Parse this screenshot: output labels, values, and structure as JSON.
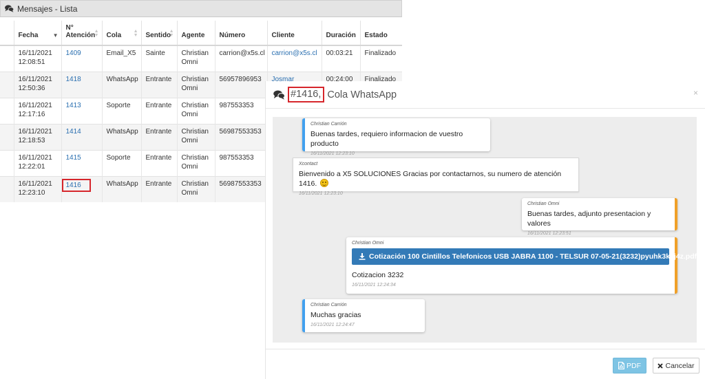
{
  "list_panel": {
    "title": "Mensajes - Lista",
    "columns": [
      "Fecha",
      "N° Atención",
      "Cola",
      "Sentido",
      "Agente",
      "Número",
      "Cliente",
      "Duración",
      "Estado"
    ],
    "rows": [
      {
        "fecha": "16/11/2021 12:08:51",
        "atencion": "1409",
        "cola": "Email_X5",
        "sentido": "Sainte",
        "agente": "Christian Omni",
        "numero": "carrion@x5s.cl",
        "cliente": "carrion@x5s.cl",
        "duracion": "00:03:21",
        "estado": "Finalizado"
      },
      {
        "fecha": "16/11/2021 12:50:36",
        "atencion": "1418",
        "cola": "WhatsApp",
        "sentido": "Entrante",
        "agente": "Christian Omni",
        "numero": "56957896953",
        "cliente": "Josmar",
        "duracion": "00:24:00",
        "estado": "Finalizado"
      },
      {
        "fecha": "16/11/2021 12:17:16",
        "atencion": "1413",
        "cola": "Soporte",
        "sentido": "Entrante",
        "agente": "Christian Omni",
        "numero": "987553353",
        "cliente": "",
        "duracion": "",
        "estado": ""
      },
      {
        "fecha": "16/11/2021 12:18:53",
        "atencion": "1414",
        "cola": "WhatsApp",
        "sentido": "Entrante",
        "agente": "Christian Omni",
        "numero": "56987553353",
        "cliente": "",
        "duracion": "",
        "estado": ""
      },
      {
        "fecha": "16/11/2021 12:22:01",
        "atencion": "1415",
        "cola": "Soporte",
        "sentido": "Entrante",
        "agente": "Christian Omni",
        "numero": "987553353",
        "cliente": "",
        "duracion": "",
        "estado": ""
      },
      {
        "fecha": "16/11/2021 12:23:10",
        "atencion": "1416",
        "cola": "WhatsApp",
        "sentido": "Entrante",
        "agente": "Christian Omni",
        "numero": "56987553353",
        "cliente": "",
        "duracion": "",
        "estado": ""
      }
    ]
  },
  "modal": {
    "title_id": "#1416,",
    "title_rest": "Cola WhatsApp",
    "close_label": "×",
    "messages": [
      {
        "sender": "Christian Carrión",
        "text": "Buenas tardes, requiero informacion de vuestro producto",
        "time": "16/11/2021 12:23:10"
      },
      {
        "sender": "Xcontact",
        "text": "Bienvenido a X5 SOLUCIONES Gracias por contactarnos, su numero de atención 1416.",
        "time": "16/11/2021 12:23:10"
      },
      {
        "sender": "Christian Omni",
        "text": "Buenas tardes, adjunto presentacion y valores",
        "time": "16/11/2021 12:23:51"
      },
      {
        "sender": "Christian Omni",
        "attachment": "Cotización 100 Cintillos Telefonicos USB JABRA 1100 - TELSUR 07-05-21(3232)pyuhk3ksj4z.pdf",
        "text": "Cotizacion 3232",
        "time": "16/11/2021 12:24:34"
      },
      {
        "sender": "Christian Carrión",
        "text": "Muchas gracias",
        "time": "16/11/2021 12:24:47"
      }
    ],
    "footer": {
      "pdf_label": "PDF",
      "cancel_label": "Cancelar"
    }
  },
  "colors": {
    "client_accent": "#41a0ee",
    "agent_accent": "#f0a028",
    "highlight": "#d6252b",
    "link": "#2a6fb0",
    "download_button": "#337ab7"
  },
  "icons": {
    "panel": "comments-icon",
    "download": "download-icon",
    "pdf": "file-pdf-icon",
    "cancel": "times-icon"
  }
}
